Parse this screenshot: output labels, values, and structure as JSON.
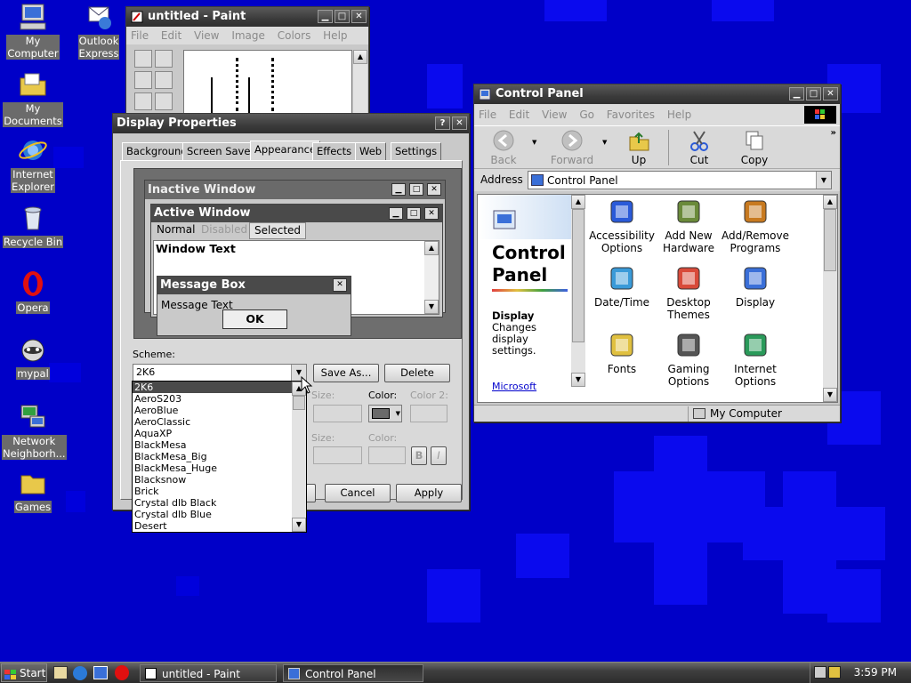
{
  "desktop": {
    "icons": [
      {
        "label": "My\nComputer",
        "selected": true,
        "icon": "my-computer-icon"
      },
      {
        "label": "Outlook\nExpress",
        "selected": true,
        "icon": "outlook-express-icon"
      },
      {
        "label": "My\nDocuments",
        "selected": true,
        "icon": "my-documents-icon"
      },
      {
        "label": "Internet\nExplorer",
        "selected": true,
        "icon": "internet-explorer-icon"
      },
      {
        "label": "Recycle Bin",
        "selected": true,
        "icon": "recycle-bin-icon"
      },
      {
        "label": "Opera",
        "selected": true,
        "icon": "opera-icon"
      },
      {
        "label": "mypal",
        "selected": true,
        "icon": "mypal-icon"
      },
      {
        "label": "Network\nNeighborh...",
        "selected": true,
        "icon": "network-neighborhood-icon"
      },
      {
        "label": "Games",
        "selected": true,
        "icon": "games-folder-icon"
      }
    ]
  },
  "paint": {
    "title": "untitled - Paint",
    "menu": [
      "File",
      "Edit",
      "View",
      "Image",
      "Colors",
      "Help"
    ]
  },
  "display": {
    "title": "Display Properties",
    "help": "?",
    "close": "✕",
    "tabs": [
      "Background",
      "Screen Saver",
      "Appearance",
      "Effects",
      "Web",
      "Settings"
    ],
    "preview": {
      "inactive": "Inactive Window",
      "active": "Active Window",
      "menu_normal": "Normal",
      "menu_disabled": "Disabled",
      "menu_selected": "Selected",
      "window_text": "Window Text",
      "msgbox_title": "Message Box",
      "msgbox_text": "Message Text",
      "ok": "OK"
    },
    "scheme_label": "Scheme:",
    "scheme_value": "2K6",
    "save_as": "Save As...",
    "delete": "Delete",
    "size_label": "Size:",
    "color_label": "Color:",
    "color2_label": "Color 2:",
    "size2_label": "Size:",
    "color3_label": "Color:",
    "bold": "B",
    "italic": "I",
    "cancel": "Cancel",
    "apply": "Apply",
    "scheme_options": [
      "2K6",
      "AeroS203",
      "AeroBlue",
      "AeroClassic",
      "AquaXP",
      "BlackMesa",
      "BlackMesa_Big",
      "BlackMesa_Huge",
      "Blacksnow",
      "Brick",
      "Crystal dlb Black",
      "Crystal dlb Blue",
      "Desert"
    ]
  },
  "cpanel": {
    "title": "Control Panel",
    "menu": [
      "File",
      "Edit",
      "View",
      "Go",
      "Favorites",
      "Help"
    ],
    "toolbar": {
      "back": "Back",
      "forward": "Forward",
      "up": "Up",
      "cut": "Cut",
      "copy": "Copy"
    },
    "address_label": "Address",
    "address_value": "Control Panel",
    "side_title": "Control Panel",
    "side_heading": "Display",
    "side_desc": "Changes display settings.",
    "side_link": "Microsoft",
    "items": [
      {
        "label": "Accessibility Options",
        "icon": "accessibility-icon"
      },
      {
        "label": "Add New Hardware",
        "icon": "add-hardware-icon"
      },
      {
        "label": "Add/Remove Programs",
        "icon": "add-remove-programs-icon"
      },
      {
        "label": "Date/Time",
        "icon": "date-time-icon"
      },
      {
        "label": "Desktop Themes",
        "icon": "desktop-themes-icon"
      },
      {
        "label": "Display",
        "icon": "display-icon"
      },
      {
        "label": "Fonts",
        "icon": "fonts-icon"
      },
      {
        "label": "Gaming Options",
        "icon": "gaming-options-icon"
      },
      {
        "label": "Internet Options",
        "icon": "internet-options-icon"
      }
    ],
    "status": "My Computer"
  },
  "taskbar": {
    "start": "Start",
    "tasks": [
      {
        "label": "untitled - Paint",
        "active": false
      },
      {
        "label": "Control Panel",
        "active": true
      }
    ],
    "clock": "3:59 PM"
  }
}
